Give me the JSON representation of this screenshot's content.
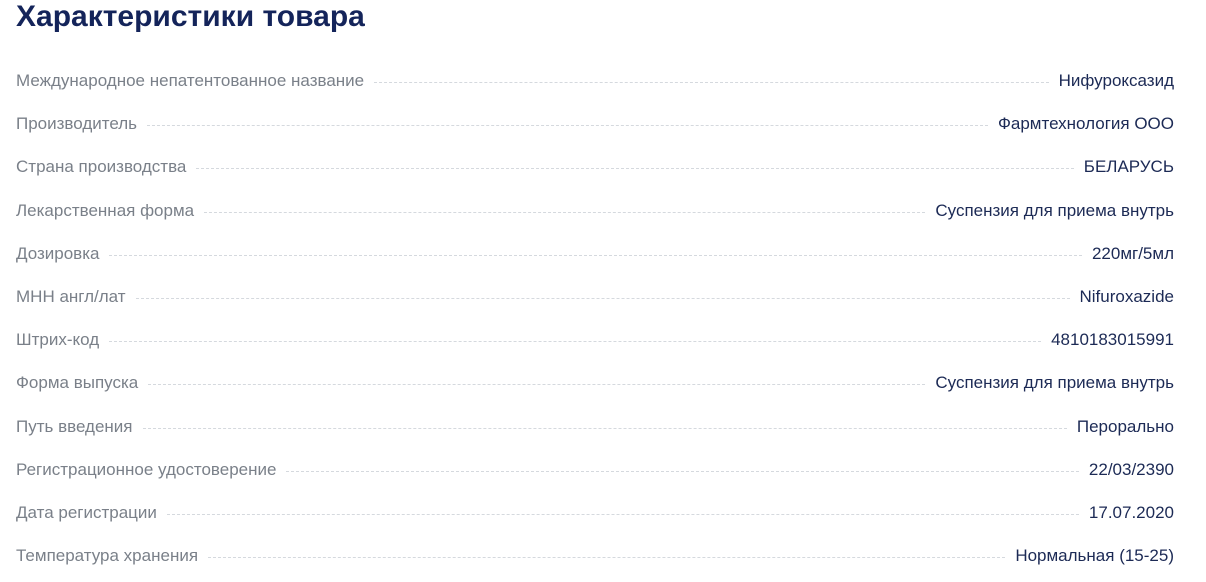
{
  "section": {
    "title": "Характеристики товара"
  },
  "specs": [
    {
      "label": "Международное непатентованное название",
      "value": "Нифуроксазид"
    },
    {
      "label": "Производитель",
      "value": "Фармтехнология ООО"
    },
    {
      "label": "Страна производства",
      "value": "БЕЛАРУСЬ"
    },
    {
      "label": "Лекарственная форма",
      "value": "Суспензия для приема внутрь"
    },
    {
      "label": "Дозировка",
      "value": "220мг/5мл"
    },
    {
      "label": "МНН англ/лат",
      "value": "Nifuroxazide"
    },
    {
      "label": "Штрих-код",
      "value": "4810183015991"
    },
    {
      "label": "Форма выпуска",
      "value": "Суспензия для приема внутрь"
    },
    {
      "label": "Путь введения",
      "value": "Перорально"
    },
    {
      "label": "Регистрационное удостоверение",
      "value": "22/03/2390"
    },
    {
      "label": "Дата регистрации",
      "value": "17.07.2020"
    },
    {
      "label": "Температура хранения",
      "value": "Нормальная (15-25)"
    }
  ]
}
